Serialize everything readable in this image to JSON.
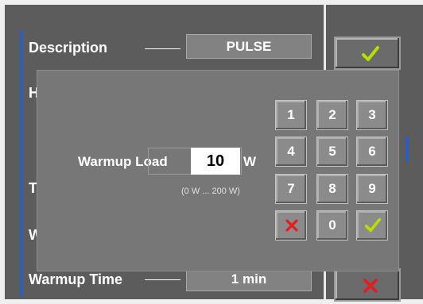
{
  "rows": {
    "description_label": "Description",
    "description_value": "PULSE",
    "h_label": "H",
    "t_label": "T",
    "w_label": "W",
    "warmup_time_label": "Warmup Time",
    "warmup_time_value": "1 min"
  },
  "dialog": {
    "field_label": "Warmup Load",
    "field_value": "10",
    "field_unit": "W",
    "range_hint": "(0 W ... 200 W)"
  },
  "keypad": {
    "keys": [
      "1",
      "2",
      "3",
      "4",
      "5",
      "6",
      "7",
      "8",
      "9",
      "0"
    ],
    "cancel_icon": "red-x-icon",
    "ok_icon": "green-check-icon"
  },
  "colors": {
    "accent_blue": "#2a5fbf",
    "check_green": "#b5e000",
    "cross_red": "#e02020"
  }
}
